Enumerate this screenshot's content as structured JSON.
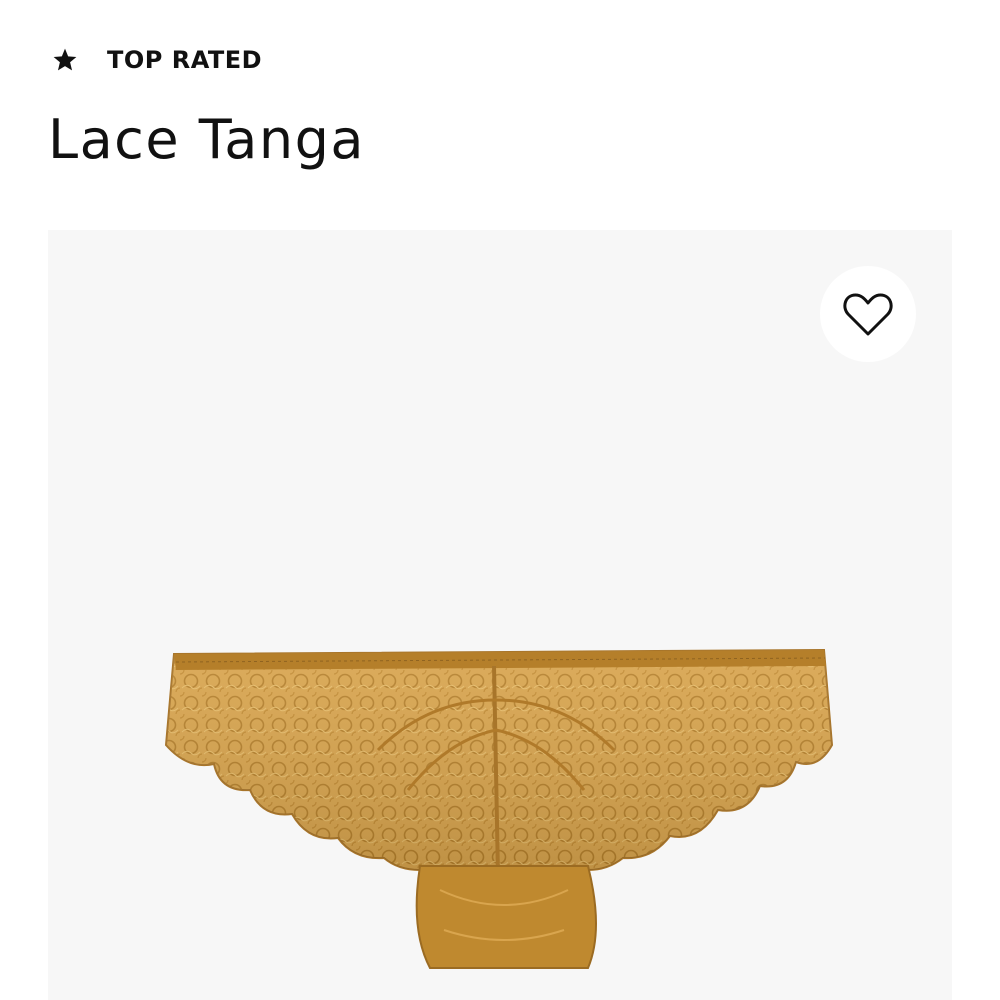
{
  "badge": {
    "icon": "star-icon",
    "label": "TOP RATED"
  },
  "product": {
    "title": "Lace Tanga",
    "color": "#c9943c"
  },
  "favorite": {
    "icon": "heart-outline-icon"
  }
}
